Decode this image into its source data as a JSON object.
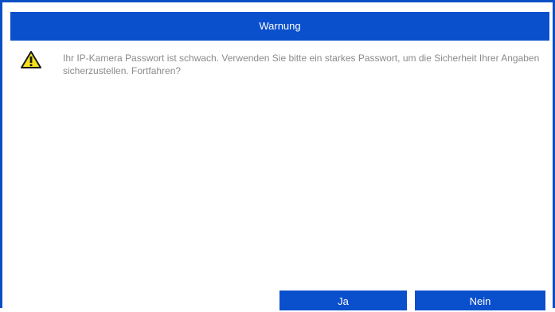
{
  "dialog": {
    "title": "Warnung",
    "icon": "warning-triangle-icon",
    "message": "Ihr IP-Kamera Passwort ist schwach. Verwenden Sie bitte ein starkes Passwort, um die Sicherheit Ihrer Angaben sicherzustellen. Fortfahren?",
    "buttons": {
      "yes_label": "Ja",
      "no_label": "Nein"
    }
  },
  "colors": {
    "accent": "#0a4fcc",
    "message_text": "#8a8a8a",
    "warning_yellow": "#f5e21b"
  }
}
